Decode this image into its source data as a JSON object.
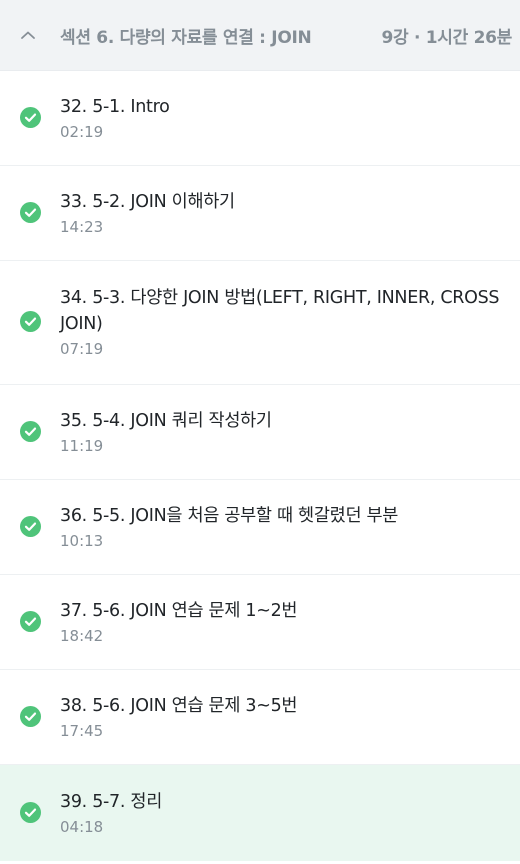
{
  "section": {
    "title": "섹션 6. 다량의 자료를 연결 : JOIN",
    "meta": "9강 · 1시간 26분"
  },
  "colors": {
    "check_green": "#4fc47a",
    "active_bg": "#e9f7f0"
  },
  "lectures": [
    {
      "title": "32. 5-1. Intro",
      "duration": "02:19"
    },
    {
      "title": "33. 5-2. JOIN 이해하기",
      "duration": "14:23"
    },
    {
      "title": "34. 5-3. 다양한 JOIN 방법(LEFT, RIGHT, INNER, CROSS JOIN)",
      "duration": "07:19"
    },
    {
      "title": "35. 5-4. JOIN 쿼리 작성하기",
      "duration": "11:19"
    },
    {
      "title": "36. 5-5. JOIN을 처음 공부할 때 헷갈렸던 부분",
      "duration": "10:13"
    },
    {
      "title": "37. 5-6. JOIN 연습 문제 1~2번",
      "duration": "18:42"
    },
    {
      "title": "38. 5-6. JOIN 연습 문제 3~5번",
      "duration": "17:45"
    },
    {
      "title": "39. 5-7. 정리",
      "duration": "04:18"
    }
  ]
}
